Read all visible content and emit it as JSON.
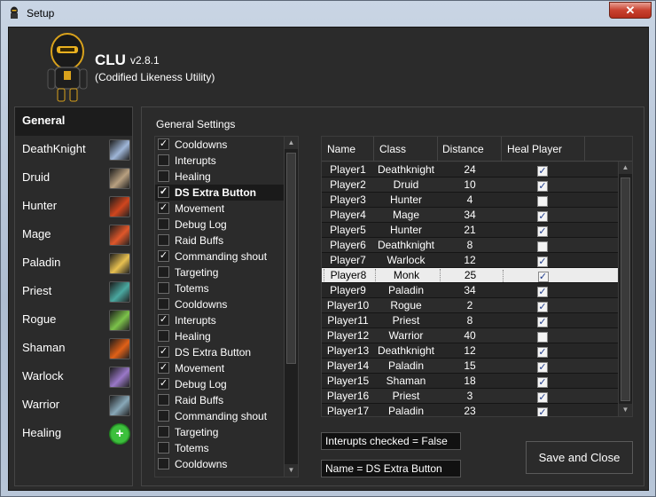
{
  "window": {
    "title": "Setup",
    "close_label": "✕"
  },
  "header": {
    "app_name": "CLU",
    "version": "v2.8.1",
    "description": "(Codified Likeness Utility)"
  },
  "sidebar": {
    "items": [
      {
        "label": "General",
        "icon": "none",
        "active": true
      },
      {
        "label": "DeathKnight",
        "icon": "deathknight-icon",
        "color": "#9fb6d8"
      },
      {
        "label": "Druid",
        "icon": "druid-icon",
        "color": "#b8a080"
      },
      {
        "label": "Hunter",
        "icon": "hunter-icon",
        "color": "#d0461e"
      },
      {
        "label": "Mage",
        "icon": "mage-icon",
        "color": "#e0572a"
      },
      {
        "label": "Paladin",
        "icon": "paladin-icon",
        "color": "#e8c050"
      },
      {
        "label": "Priest",
        "icon": "priest-icon",
        "color": "#4aa8a0"
      },
      {
        "label": "Rogue",
        "icon": "rogue-icon",
        "color": "#7cc24a"
      },
      {
        "label": "Shaman",
        "icon": "shaman-icon",
        "color": "#e06018"
      },
      {
        "label": "Warlock",
        "icon": "warlock-icon",
        "color": "#9a78c8"
      },
      {
        "label": "Warrior",
        "icon": "warrior-icon",
        "color": "#88a8b8"
      },
      {
        "label": "Healing",
        "icon": "healing-icon",
        "color": "#2fa12f"
      }
    ]
  },
  "settings": {
    "label": "General Settings",
    "items": [
      {
        "label": "Cooldowns",
        "checked": true
      },
      {
        "label": "Interupts",
        "checked": false
      },
      {
        "label": "Healing",
        "checked": false
      },
      {
        "label": "DS Extra Button",
        "checked": true,
        "selected": true
      },
      {
        "label": "Movement",
        "checked": true
      },
      {
        "label": "Debug Log",
        "checked": false
      },
      {
        "label": "Raid Buffs",
        "checked": false
      },
      {
        "label": "Commanding shout",
        "checked": true
      },
      {
        "label": "Targeting",
        "checked": false
      },
      {
        "label": "Totems",
        "checked": false
      },
      {
        "label": "Cooldowns",
        "checked": false
      },
      {
        "label": "Interupts",
        "checked": true
      },
      {
        "label": "Healing",
        "checked": false
      },
      {
        "label": "DS Extra Button",
        "checked": true
      },
      {
        "label": "Movement",
        "checked": true
      },
      {
        "label": "Debug Log",
        "checked": true
      },
      {
        "label": "Raid Buffs",
        "checked": false
      },
      {
        "label": "Commanding shout",
        "checked": false
      },
      {
        "label": "Targeting",
        "checked": false
      },
      {
        "label": "Totems",
        "checked": false
      },
      {
        "label": "Cooldowns",
        "checked": false
      }
    ]
  },
  "table": {
    "columns": [
      "Name",
      "Class",
      "Distance",
      "Heal Player"
    ],
    "rows": [
      {
        "name": "Player1",
        "class": "Deathknight",
        "distance": "24",
        "heal": true
      },
      {
        "name": "Player2",
        "class": "Druid",
        "distance": "10",
        "heal": true
      },
      {
        "name": "Player3",
        "class": "Hunter",
        "distance": "4",
        "heal": false
      },
      {
        "name": "Player4",
        "class": "Mage",
        "distance": "34",
        "heal": true
      },
      {
        "name": "Player5",
        "class": "Hunter",
        "distance": "21",
        "heal": true
      },
      {
        "name": "Player6",
        "class": "Deathknight",
        "distance": "8",
        "heal": false
      },
      {
        "name": "Player7",
        "class": "Warlock",
        "distance": "12",
        "heal": true
      },
      {
        "name": "Player8",
        "class": "Monk",
        "distance": "25",
        "heal": true,
        "selected": true
      },
      {
        "name": "Player9",
        "class": "Paladin",
        "distance": "34",
        "heal": true
      },
      {
        "name": "Player10",
        "class": "Rogue",
        "distance": "2",
        "heal": true
      },
      {
        "name": "Player11",
        "class": "Priest",
        "distance": "8",
        "heal": true
      },
      {
        "name": "Player12",
        "class": "Warrior",
        "distance": "40",
        "heal": false
      },
      {
        "name": "Player13",
        "class": "Deathknight",
        "distance": "12",
        "heal": true
      },
      {
        "name": "Player14",
        "class": "Paladin",
        "distance": "15",
        "heal": true
      },
      {
        "name": "Player15",
        "class": "Shaman",
        "distance": "18",
        "heal": true
      },
      {
        "name": "Player16",
        "class": "Priest",
        "distance": "3",
        "heal": true
      },
      {
        "name": "Player17",
        "class": "Paladin",
        "distance": "23",
        "heal": true
      }
    ]
  },
  "status": {
    "interrupts": "Interupts checked = False",
    "name": "Name = DS Extra Button"
  },
  "buttons": {
    "save_close": "Save and Close"
  }
}
